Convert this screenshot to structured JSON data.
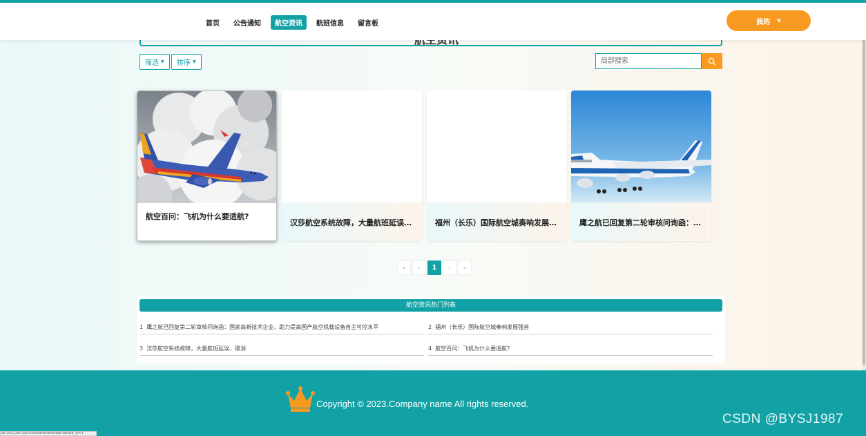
{
  "nav": {
    "items": [
      {
        "label": "首页",
        "active": false
      },
      {
        "label": "公告通知",
        "active": false
      },
      {
        "label": "航空资讯",
        "active": true
      },
      {
        "label": "航班信息",
        "active": false
      },
      {
        "label": "留言板",
        "active": false
      }
    ],
    "my_button": "我的"
  },
  "page": {
    "title": "航空资讯"
  },
  "filters": {
    "filter_label": "筛选",
    "sort_label": "排序",
    "search_placeholder": "局部搜索"
  },
  "cards": [
    {
      "title": "航空百问：飞机为什么要适航?",
      "image": "southwest-plane-clouds"
    },
    {
      "title": "汉莎航空系统故障，大量航班延误、取消",
      "image": "blank"
    },
    {
      "title": "福州（长乐）国际航空城奏响发展强音",
      "image": "blank"
    },
    {
      "title": "鹰之航已回复第二轮审核问询函：国家高新技术企业",
      "image": "cargo-747"
    }
  ],
  "pagination": {
    "first": "«",
    "prev": "‹",
    "current": "1",
    "next": "›",
    "last": "»"
  },
  "hot_list": {
    "title": "航空资讯热门列表",
    "items": [
      {
        "index": "1",
        "text": "鹰之航已回复第二轮审核问询函：国家高新技术企业，助力提高国产航空机载设备自主可控水平"
      },
      {
        "index": "2",
        "text": "福州（长乐）国际航空城奏响发展强音"
      },
      {
        "index": "3",
        "text": "汉莎航空系统故障，大量航班延误、取消"
      },
      {
        "index": "4",
        "text": "航空百问：飞机为什么要适航?"
      }
    ]
  },
  "footer": {
    "copyright": "Copyright © 2023.Company name All rights reserved.",
    "watermark": "CSDN @BYSJ1987"
  },
  "status_url": "39.100.108.200:8069/article/detail?article_id=1",
  "colors": {
    "primary": "#12a2a6",
    "accent": "#f79a1f"
  }
}
